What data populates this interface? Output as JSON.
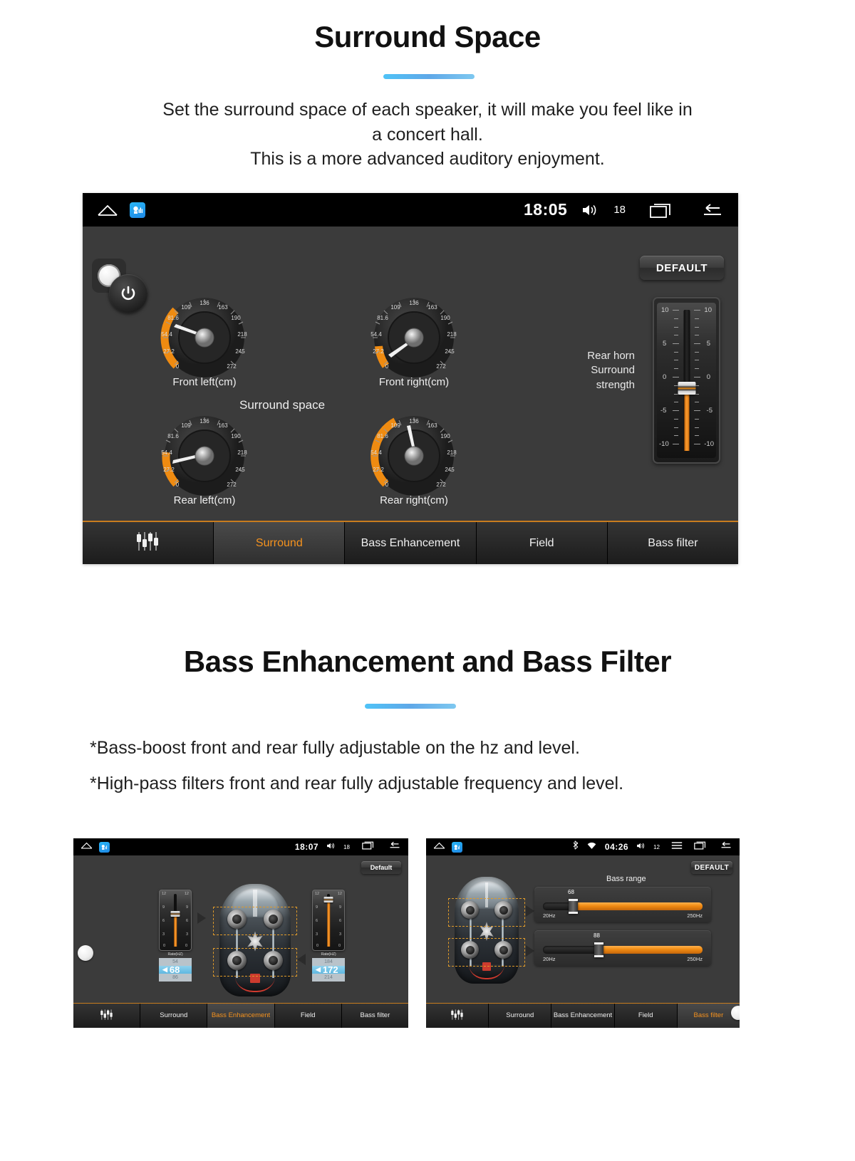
{
  "sections": [
    {
      "title": "Surround Space",
      "desc_line1": "Set the surround space of each speaker, it will make you feel like in",
      "desc_line2": "a concert hall.",
      "desc_line3": "This is a more advanced auditory enjoyment."
    },
    {
      "title": "Bass Enhancement and Bass Filter",
      "bullet1": "*Bass-boost front and rear fully adjustable on the hz and level.",
      "bullet2": "*High-pass filters front and rear fully adjustable frequency and level."
    }
  ],
  "surround_screen": {
    "statusbar": {
      "time": "18:05",
      "volume": "18"
    },
    "default_button": "DEFAULT",
    "center_label": "Surround space",
    "rear_horn_label_line1": "Rear horn",
    "rear_horn_label_line2": "Surround",
    "rear_horn_label_line3": "strength",
    "dial_ticks": [
      "0",
      "27.2",
      "54.4",
      "81.6",
      "109",
      "136",
      "163",
      "190",
      "218",
      "245",
      "272"
    ],
    "dials": [
      {
        "id": "front-left",
        "label": "Front left(cm)",
        "value_pct": 17
      },
      {
        "id": "front-right",
        "label": "Front right(cm)",
        "value_pct": 9
      },
      {
        "id": "rear-left",
        "label": "Rear left(cm)",
        "value_pct": 14
      },
      {
        "id": "rear-right",
        "label": "Rear right(cm)",
        "value_pct": 38
      }
    ],
    "slider": {
      "scale": [
        "10",
        "5",
        "0",
        "-5",
        "-10"
      ],
      "value": "-1"
    },
    "tabs": [
      {
        "label": "",
        "icon": "equalizer-icon",
        "active": false
      },
      {
        "label": "Surround",
        "active": true
      },
      {
        "label": "Bass Enhancement",
        "active": false
      },
      {
        "label": "Field",
        "active": false
      },
      {
        "label": "Bass filter",
        "active": false
      }
    ]
  },
  "bass_enhancement_screen": {
    "statusbar": {
      "time": "18:07",
      "volume": "18"
    },
    "default_button": "Default",
    "faders": [
      {
        "position": "front",
        "scale": [
          "12",
          "9",
          "6",
          "3",
          "0"
        ],
        "caption": "Rate(HZ)",
        "picker": {
          "above": "54",
          "selected": "68",
          "below": "86"
        },
        "fill_pct": 72
      },
      {
        "position": "rear",
        "scale": [
          "12",
          "9",
          "6",
          "3",
          "0"
        ],
        "caption": "Rate(HZ)",
        "picker": {
          "above": "184",
          "selected": "172",
          "below": "214"
        },
        "fill_pct": 90
      }
    ],
    "tabs": [
      {
        "label": "",
        "icon": "equalizer-icon",
        "active": false
      },
      {
        "label": "Surround",
        "active": false
      },
      {
        "label": "Bass Enhancement",
        "active": true
      },
      {
        "label": "Field",
        "active": false
      },
      {
        "label": "Bass filter",
        "active": false
      }
    ]
  },
  "bass_filter_screen": {
    "statusbar": {
      "time": "04:26",
      "volume": "12"
    },
    "default_button": "DEFAULT",
    "title": "Bass range",
    "sliders": [
      {
        "position": "front",
        "value": "68",
        "min": "20Hz",
        "max": "250Hz",
        "handle_pct": 17
      },
      {
        "position": "rear",
        "value": "88",
        "min": "20Hz",
        "max": "250Hz",
        "handle_pct": 31
      }
    ],
    "tabs": [
      {
        "label": "",
        "icon": "equalizer-icon",
        "active": false
      },
      {
        "label": "Surround",
        "active": false
      },
      {
        "label": "Bass Enhancement",
        "active": false
      },
      {
        "label": "Field",
        "active": false
      },
      {
        "label": "Bass filter",
        "active": true
      }
    ]
  },
  "colors": {
    "accent_orange": "#f5921e",
    "accent_blue": "#4fc3f7",
    "screen_bg": "#3b3b3b",
    "statusbar_bg": "#000000"
  }
}
